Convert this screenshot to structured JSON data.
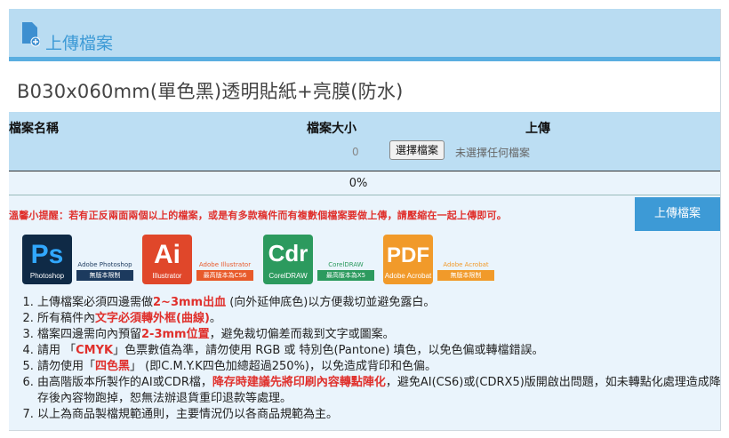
{
  "header": {
    "title": "上傳檔案"
  },
  "product": {
    "name": "B030x060mm(單色黑)透明貼紙+亮膜(防水)"
  },
  "table": {
    "col_name": "檔案名稱",
    "col_size": "檔案大小",
    "col_upload": "上傳",
    "size_value": "0",
    "choose_label": "選擇檔案",
    "no_file_text": "未選擇任何檔案",
    "progress": "0%"
  },
  "notice": "溫馨小提醒：若有正反兩面兩個以上的檔案，或是有多款稿件而有複數個檔案要做上傳，請壓縮在一起上傳即可。",
  "upload_button": "上傳檔案",
  "logos": [
    {
      "big": "Ps",
      "small": "Photoshop",
      "cap": "Adobe Photoshop",
      "tag": "無版本限制",
      "color": "#1c3a5e",
      "accent": "#31a8ff"
    },
    {
      "big": "Ai",
      "small": "Illustrator",
      "cap": "Adobe Illustrator",
      "tag": "最高版本為CS6",
      "color": "#e85a2a",
      "accent": "#ffb000"
    },
    {
      "big": "Cdr",
      "small": "CorelDRAW",
      "cap": "CorelDRAW",
      "tag": "最高版本為X5",
      "color": "#2c9a5e",
      "accent": "#1c7c4a"
    },
    {
      "big": "PDF",
      "small": "Adobe Acrobat",
      "cap": "Adobe Acrobat",
      "tag": "無版本限制",
      "color": "#f19a2a",
      "accent": "#f19a2a"
    }
  ],
  "rules": [
    {
      "pre": "上傳檔案必須四邊需做",
      "red": "2~3mm出血",
      "post": " (向外延伸底色)以方便裁切並避免露白。"
    },
    {
      "pre": "所有稿件內",
      "red": "文字必須轉外框(曲線)",
      "post": "。"
    },
    {
      "pre": "檔案四邊需向內預留",
      "red": "2-3mm位置",
      "post": "，避免裁切偏差而裁到文字或圖案。"
    },
    {
      "pre": "請用 「",
      "red": "CMYK",
      "post": "」色票數值為準，請勿使用 RGB 或 特別色(Pantone) 填色，以免色偏或轉檔錯誤。"
    },
    {
      "pre": "請勿使用「",
      "red": "四色黑",
      "post": "」 (即C.M.Y.K四色加總超過250%)，以免造成背印和色偏。"
    },
    {
      "pre": "由高階版本所製作的AI或CDR檔，",
      "red": "降存時建議先將印刷內容轉點陣化",
      "post": "，避免AI(CS6)或(CDRX5)版開啟出問題，如未轉點化處理造成降存後內容物跑掉，恕無法辦退貨重印退款等處理。"
    },
    {
      "pre": "以上為商品製檔規範通則，主要情況仍以各商品規範為主。",
      "red": "",
      "post": ""
    }
  ]
}
